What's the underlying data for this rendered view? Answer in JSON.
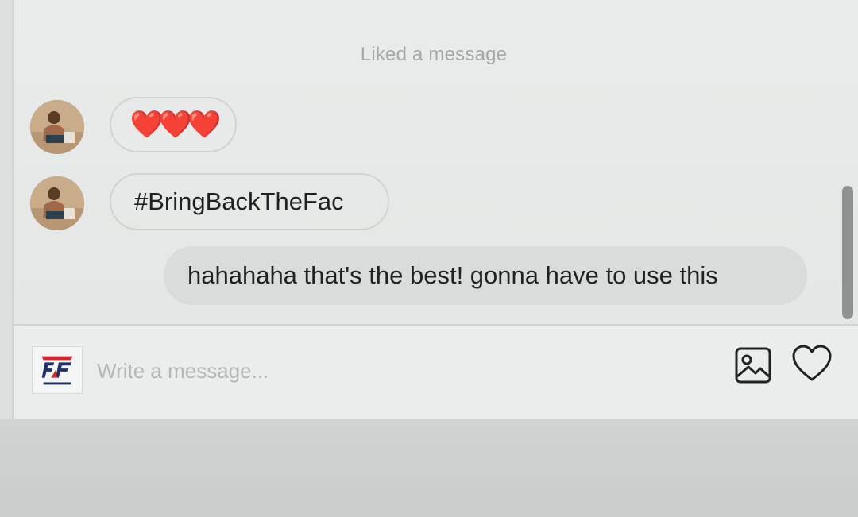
{
  "conversation": {
    "system_note": "Liked a message",
    "messages": [
      {
        "direction": "received",
        "text": "❤️❤️❤️",
        "avatar_icon": "user-avatar-photo"
      },
      {
        "direction": "received",
        "text": "#BringBackTheFac",
        "avatar_icon": "user-avatar-photo"
      },
      {
        "direction": "sent",
        "text": "hahahaha that's the best! gonna have to use this"
      }
    ]
  },
  "composer": {
    "placeholder": "Write a message...",
    "value": "",
    "brand_logo_icon": "faze-clan-logo",
    "image_button_icon": "image-icon",
    "like_button_icon": "heart-outline-icon"
  },
  "colors": {
    "heart_red": "#e5202a",
    "logo_red": "#d6262e",
    "logo_navy": "#1f2f6b"
  }
}
